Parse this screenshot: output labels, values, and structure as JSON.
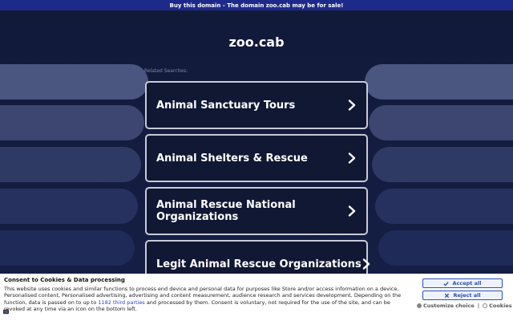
{
  "topbar": {
    "text": "Buy this domain - The domain zoo.cab may be for sale!"
  },
  "domain": {
    "title": "zoo.cab"
  },
  "related": {
    "label": "Related Searches:"
  },
  "cards": [
    {
      "label": "Animal Sanctuary Tours"
    },
    {
      "label": "Animal Shelters & Rescue"
    },
    {
      "label": "Animal Rescue National Organizations"
    },
    {
      "label": "Legit Animal Rescue Organizations"
    }
  ],
  "icons": {
    "card_arrow": "chevron-right-icon",
    "accept": "check-icon",
    "reject": "x-icon",
    "footer": "shield-icon",
    "customize": "gear-icon",
    "cookies": "cookie-icon"
  },
  "colors": {
    "topbar": "#1e2a8a",
    "background": "#0f1630",
    "card_border": "#c8cbd6",
    "button": "#2d4fb8"
  },
  "consent": {
    "title": "Consent to Cookies & Data processing",
    "body_part1": "This website uses cookies and similar functions to process end device and personal data for purposes like Store and/or access information on a device, Personalised content, Personalised advertising, advertising and content measurement, audience research and services development. Depending on the function, data is passed on to up to ",
    "third_parties_link": "1182 third parties",
    "body_part2": " and processed by them. Consent is voluntary, not required for the use of the site, and can be revoked at any time via an icon on the bottom left.",
    "accept_label": "Accept all",
    "reject_label": "Reject all",
    "customize_label": "Customize choice",
    "separator": "|",
    "cookies_label": "Cookies"
  }
}
